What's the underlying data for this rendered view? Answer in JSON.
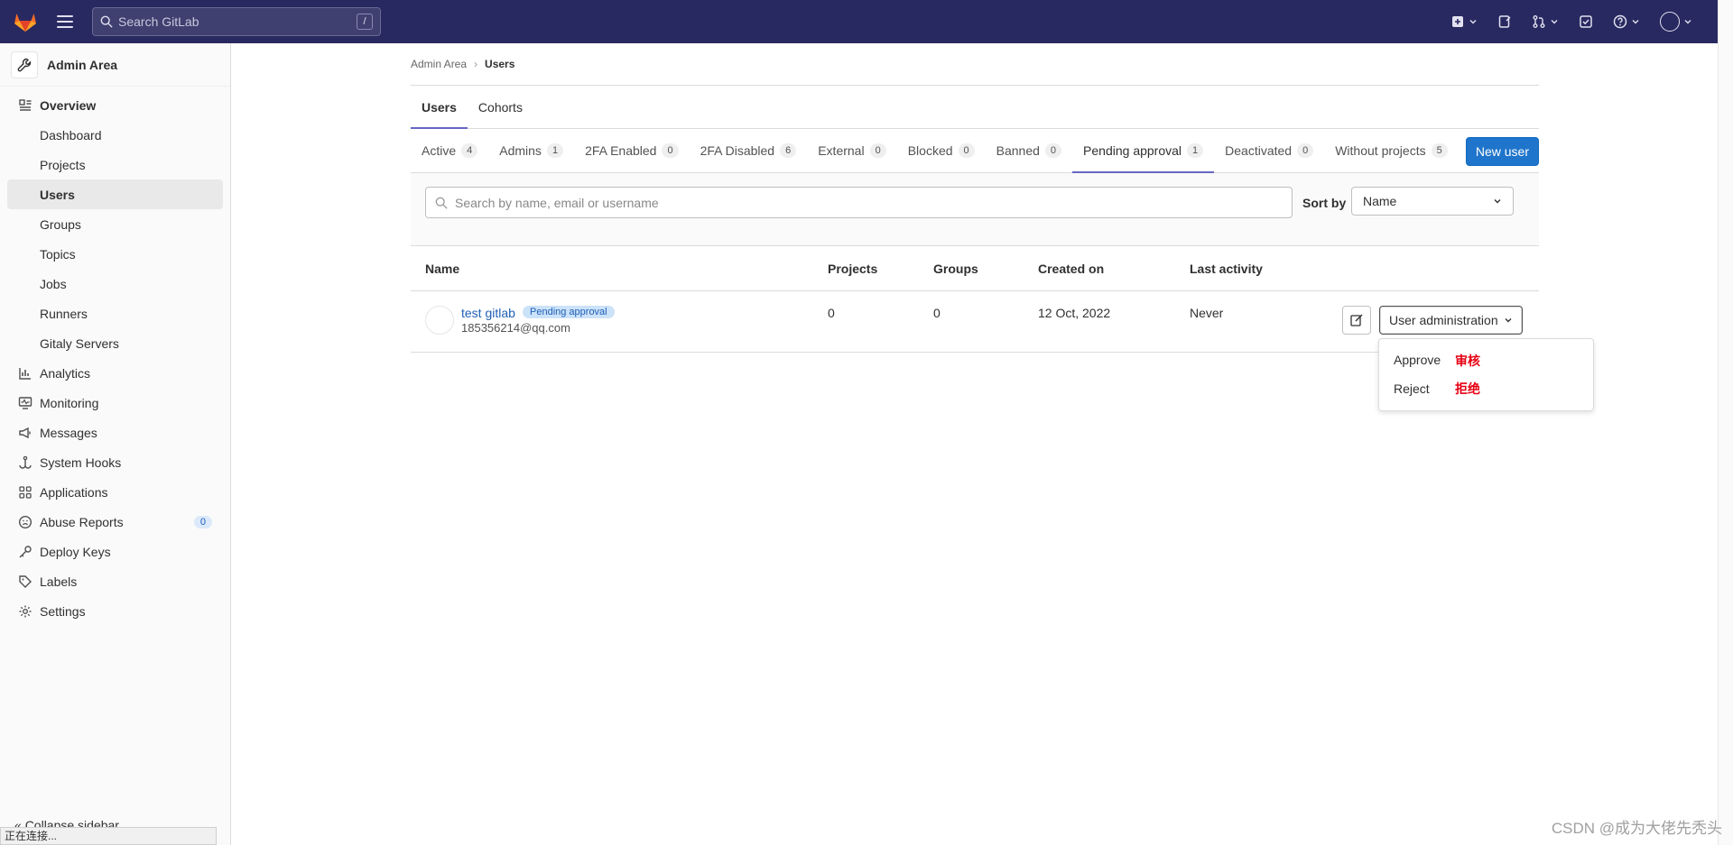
{
  "topbar": {
    "search_placeholder": "Search GitLab",
    "search_shortcut": "/"
  },
  "sidebar": {
    "title": "Admin Area",
    "items": [
      {
        "label": "Overview",
        "icon": "overview-icon",
        "level": "top"
      },
      {
        "label": "Dashboard",
        "level": "sub"
      },
      {
        "label": "Projects",
        "level": "sub"
      },
      {
        "label": "Users",
        "level": "sub",
        "active": true
      },
      {
        "label": "Groups",
        "level": "sub"
      },
      {
        "label": "Topics",
        "level": "sub"
      },
      {
        "label": "Jobs",
        "level": "sub"
      },
      {
        "label": "Runners",
        "level": "sub"
      },
      {
        "label": "Gitaly Servers",
        "level": "sub"
      },
      {
        "label": "Analytics",
        "icon": "chart-icon",
        "level": "top"
      },
      {
        "label": "Monitoring",
        "icon": "monitor-icon",
        "level": "top"
      },
      {
        "label": "Messages",
        "icon": "bullhorn-icon",
        "level": "top"
      },
      {
        "label": "System Hooks",
        "icon": "hook-icon",
        "level": "top"
      },
      {
        "label": "Applications",
        "icon": "applications-icon",
        "level": "top"
      },
      {
        "label": "Abuse Reports",
        "icon": "abuse-icon",
        "level": "top",
        "badge": "0"
      },
      {
        "label": "Deploy Keys",
        "icon": "key-icon",
        "level": "top"
      },
      {
        "label": "Labels",
        "icon": "label-icon",
        "level": "top"
      },
      {
        "label": "Settings",
        "icon": "settings-icon",
        "level": "top"
      }
    ],
    "collapse_label": "Collapse sidebar",
    "status_text": "正在连接..."
  },
  "breadcrumb": {
    "parent": "Admin Area",
    "current": "Users"
  },
  "main_tabs": [
    {
      "label": "Users",
      "active": true
    },
    {
      "label": "Cohorts"
    }
  ],
  "filter_tabs": [
    {
      "label": "Active",
      "count": "4"
    },
    {
      "label": "Admins",
      "count": "1"
    },
    {
      "label": "2FA Enabled",
      "count": "0"
    },
    {
      "label": "2FA Disabled",
      "count": "6"
    },
    {
      "label": "External",
      "count": "0"
    },
    {
      "label": "Blocked",
      "count": "0"
    },
    {
      "label": "Banned",
      "count": "0"
    },
    {
      "label": "Pending approval",
      "count": "1",
      "active": true
    },
    {
      "label": "Deactivated",
      "count": "0"
    },
    {
      "label": "Without projects",
      "count": "5"
    }
  ],
  "new_user_label": "New user",
  "filter": {
    "search_placeholder": "Search by name, email or username",
    "sort_label": "Sort by",
    "sort_value": "Name"
  },
  "table": {
    "headers": [
      "Name",
      "Projects",
      "Groups",
      "Created on",
      "Last activity"
    ],
    "rows": [
      {
        "name": "test gitlab",
        "badge": "Pending approval",
        "email": "185356214@qq.com",
        "projects": "0",
        "groups": "0",
        "created_on": "12 Oct, 2022",
        "last_activity": "Never",
        "admin_label": "User administration"
      }
    ]
  },
  "dropdown": {
    "items": [
      {
        "label": "Approve",
        "note": "审核"
      },
      {
        "label": "Reject",
        "note": "拒绝"
      }
    ]
  },
  "watermark": "CSDN @成为大佬先秃头",
  "colors": {
    "topbar": "#292961",
    "primary": "#1f75cb",
    "note_red": "#e60012",
    "tab_underline": "#6666c4"
  }
}
